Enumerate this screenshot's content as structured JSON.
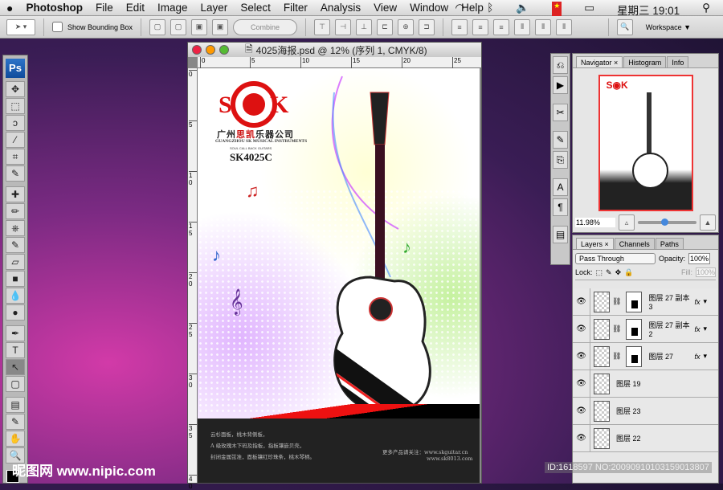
{
  "menubar": {
    "app": "Photoshop",
    "items": [
      "File",
      "Edit",
      "Image",
      "Layer",
      "Select",
      "Filter",
      "Analysis",
      "View",
      "Window",
      "Help"
    ],
    "clock": "星期三 19:01"
  },
  "options": {
    "show_bounding_box": "Show Bounding Box",
    "combine": "Combine",
    "workspace": "Workspace ▼"
  },
  "tools": {
    "logo": "Ps",
    "items": [
      "✥",
      "⬚",
      "ↄ",
      "⁄",
      "⌗",
      "✎",
      "✚",
      "✏",
      "⎈",
      "✎",
      "▱",
      "■",
      "💧",
      "●",
      "✒",
      "T",
      "↖",
      "▢",
      "▤",
      "✎",
      "✋",
      "🔍"
    ]
  },
  "document": {
    "title": "4025海报.psd @ 12% (序列 1, CMYK/8)",
    "ruler_top": [
      "0",
      "5",
      "10",
      "15",
      "20",
      "25"
    ],
    "ruler_left": [
      "0",
      "5",
      "1\n0",
      "1\n5",
      "2\n0",
      "2\n5",
      "3\n0",
      "3\n5",
      "4\n0"
    ]
  },
  "poster": {
    "brand_cn_1": "广州",
    "brand_cn_2": "思凯",
    "brand_cn_3": "乐器公司",
    "brand_en": "GUANGZHOU SK MUSICAL INSTRUMENTS",
    "tagline": "SOUL CALL BACK GUITARS",
    "model": "SK4025C",
    "logo_letters": "S K",
    "features": [
      "云杉面板，桃木背侧板，",
      "A 级玫瑰木下码及指板，指板镶嵌贝壳，",
      "封闭金属弦准，面板镶红珍珠条，桃木琴柄。"
    ],
    "more": "更多产品请关注：www.skguitar.cn",
    "site2": "www.sk8013.com"
  },
  "navigator": {
    "tabs": [
      "Navigator",
      "Histogram",
      "Info"
    ],
    "zoom": "11.98%",
    "slider": 0.4
  },
  "layers": {
    "tabs": [
      "Layers",
      "Channels",
      "Paths"
    ],
    "blend": "Pass Through",
    "opacity_label": "Opacity:",
    "opacity": "100%",
    "lock": "Lock:",
    "fill_label": "Fill:",
    "fill": "100%",
    "rows": [
      {
        "name": "图层 27 副本 3",
        "fx": "fx",
        "mask": true
      },
      {
        "name": "图层 27 副本 2",
        "fx": "fx",
        "mask": true
      },
      {
        "name": "图层 27",
        "fx": "fx",
        "mask": true
      },
      {
        "name": "图层 19",
        "fx": "",
        "mask": false
      },
      {
        "name": "图层 23",
        "fx": "",
        "mask": false
      },
      {
        "name": "图层 22",
        "fx": "",
        "mask": false
      }
    ]
  },
  "watermark": "昵图网 www.nipic.com",
  "id_text": "ID:1618597 NO:20090910103159013807"
}
